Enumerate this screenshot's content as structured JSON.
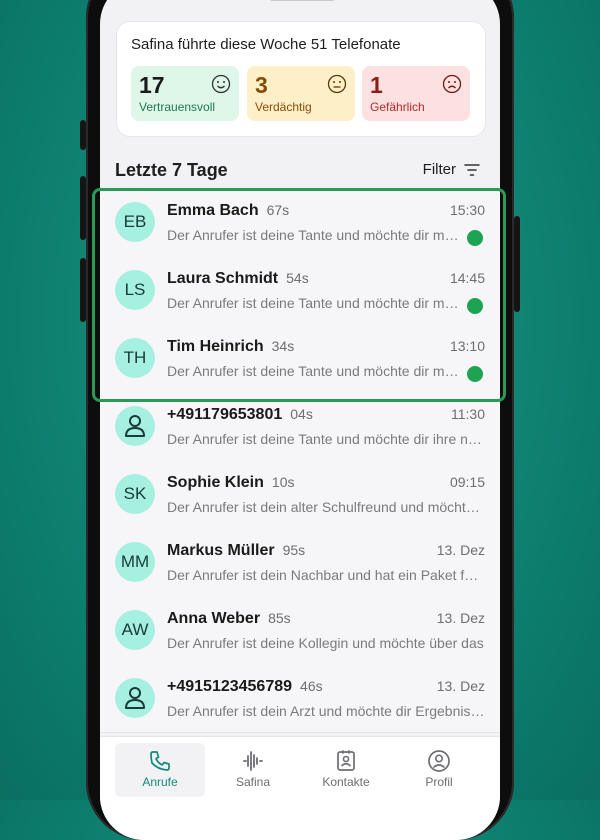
{
  "summary": {
    "title": "Safina führte diese Woche 51 Telefonate",
    "stats": [
      {
        "value": "17",
        "label": "Vertrauensvoll",
        "icon": "smile-face-icon"
      },
      {
        "value": "3",
        "label": "Verdächtig",
        "icon": "neutral-face-icon"
      },
      {
        "value": "1",
        "label": "Gefährlich",
        "icon": "sad-face-icon"
      }
    ]
  },
  "list_header": {
    "title": "Letzte 7 Tage",
    "filter_label": "Filter"
  },
  "calls": [
    {
      "initials": "EB",
      "name": "Emma Bach",
      "duration": "67s",
      "time": "15:30",
      "snippet": "Der Anrufer ist deine Tante und möchte dir mitteilen",
      "status": "trusted"
    },
    {
      "initials": "LS",
      "name": "Laura Schmidt",
      "duration": "54s",
      "time": "14:45",
      "snippet": "Der Anrufer ist deine Tante und möchte dir mitteilen",
      "status": "trusted"
    },
    {
      "initials": "TH",
      "name": "Tim Heinrich",
      "duration": "34s",
      "time": "13:10",
      "snippet": "Der Anrufer ist deine Tante und möchte dir mitteilen",
      "status": "trusted"
    },
    {
      "initials": "",
      "name": "+491179653801",
      "duration": "04s",
      "time": "11:30",
      "snippet": "Der Anrufer ist deine Tante und möchte dir ihre neue",
      "status": ""
    },
    {
      "initials": "SK",
      "name": "Sophie Klein",
      "duration": "10s",
      "time": "09:15",
      "snippet": "Der Anrufer ist dein alter Schulfreund und möchte dich",
      "status": ""
    },
    {
      "initials": "MM",
      "name": "Markus Müller",
      "duration": "95s",
      "time": "13. Dez",
      "snippet": "Der Anrufer ist dein Nachbar und hat ein Paket für dich",
      "status": ""
    },
    {
      "initials": "AW",
      "name": "Anna Weber",
      "duration": "85s",
      "time": "13. Dez",
      "snippet": "Der Anrufer ist deine Kollegin und möchte über das",
      "status": ""
    },
    {
      "initials": "",
      "name": "+4915123456789",
      "duration": "46s",
      "time": "13. Dez",
      "snippet": "Der Anrufer ist dein Arzt und möchte dir Ergebnisse",
      "status": ""
    }
  ],
  "tabs": [
    {
      "label": "Anrufe",
      "icon": "phone-icon",
      "active": true
    },
    {
      "label": "Safina",
      "icon": "waveform-icon",
      "active": false
    },
    {
      "label": "Kontakte",
      "icon": "contacts-icon",
      "active": false
    },
    {
      "label": "Profil",
      "icon": "profile-icon",
      "active": false
    }
  ],
  "colors": {
    "background": "#0c7c6d",
    "accent": "#0f8a7a",
    "trusted_dot": "#1ea352",
    "avatar": "#a6f0e1"
  }
}
